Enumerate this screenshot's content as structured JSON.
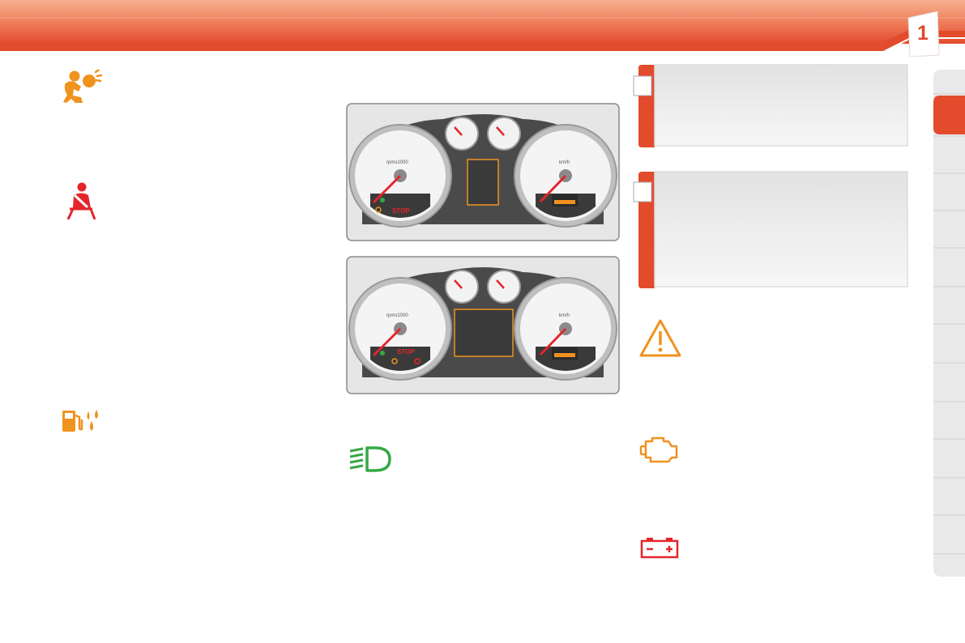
{
  "header": {
    "chapter_number": "1",
    "colors": {
      "band_light": "#f4a37f",
      "band_dark": "#e24b2c",
      "accent": "#e8502e"
    }
  },
  "left_column": {
    "icons": [
      {
        "name": "airbag-icon",
        "color": "#f0921e"
      },
      {
        "name": "seatbelt-icon",
        "color": "#e3262b"
      },
      {
        "name": "fuel-fluid-icon",
        "color": "#f0921e"
      }
    ]
  },
  "middle_column": {
    "clusters": [
      {
        "name": "instrument-cluster-1",
        "tach_ticks": [
          "0",
          "1",
          "2",
          "3",
          "4",
          "5",
          "6",
          "7"
        ],
        "speed_ticks": [
          "10",
          "30",
          "50",
          "70",
          "90",
          "110",
          "130",
          "150",
          "170",
          "200",
          "230"
        ],
        "tach_unit": "rpmx1000",
        "speed_unit": "km/h",
        "stop_text": "STOP"
      },
      {
        "name": "instrument-cluster-2",
        "tach_ticks": [
          "0",
          "1",
          "2",
          "3",
          "4",
          "5",
          "6",
          "7"
        ],
        "speed_ticks": [
          "10",
          "30",
          "50",
          "70",
          "90",
          "110",
          "130",
          "150",
          "170",
          "200",
          "230"
        ],
        "tach_unit": "rpmx1000",
        "speed_unit": "km/h",
        "stop_text": "STOP"
      }
    ],
    "icons": [
      {
        "name": "headlight-icon",
        "color": "#35a845"
      }
    ]
  },
  "right_column": {
    "callout_boxes": [
      {
        "name": "info-box-1"
      },
      {
        "name": "info-box-2"
      }
    ],
    "icons": [
      {
        "name": "warning-triangle-icon",
        "color": "#f0921e"
      },
      {
        "name": "engine-icon",
        "color": "#f0921e"
      },
      {
        "name": "battery-icon",
        "color": "#e3262b"
      }
    ]
  },
  "side_tabs": {
    "count": 13,
    "active_index": 0,
    "active_color": "#e24b2c"
  }
}
